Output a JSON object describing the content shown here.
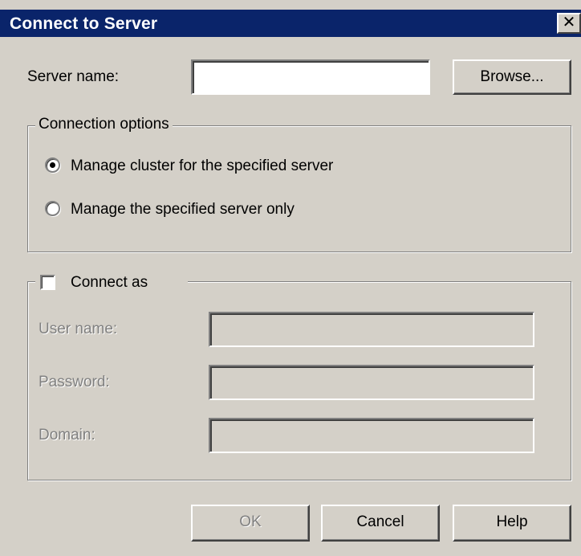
{
  "window": {
    "title": "Connect to Server",
    "close_glyph": "✕"
  },
  "server": {
    "label": "Server name:",
    "value": "",
    "browse_label": "Browse..."
  },
  "connection_options": {
    "legend": "Connection options",
    "options": [
      {
        "label": "Manage cluster for the specified server",
        "selected": true
      },
      {
        "label": "Manage the specified server only",
        "selected": false
      }
    ]
  },
  "connect_as": {
    "label": "Connect as",
    "checked": false,
    "fields": [
      {
        "label": "User name:",
        "value": ""
      },
      {
        "label": "Password:",
        "value": ""
      },
      {
        "label": "Domain:",
        "value": ""
      }
    ]
  },
  "buttons": {
    "ok": "OK",
    "cancel": "Cancel",
    "help": "Help"
  }
}
